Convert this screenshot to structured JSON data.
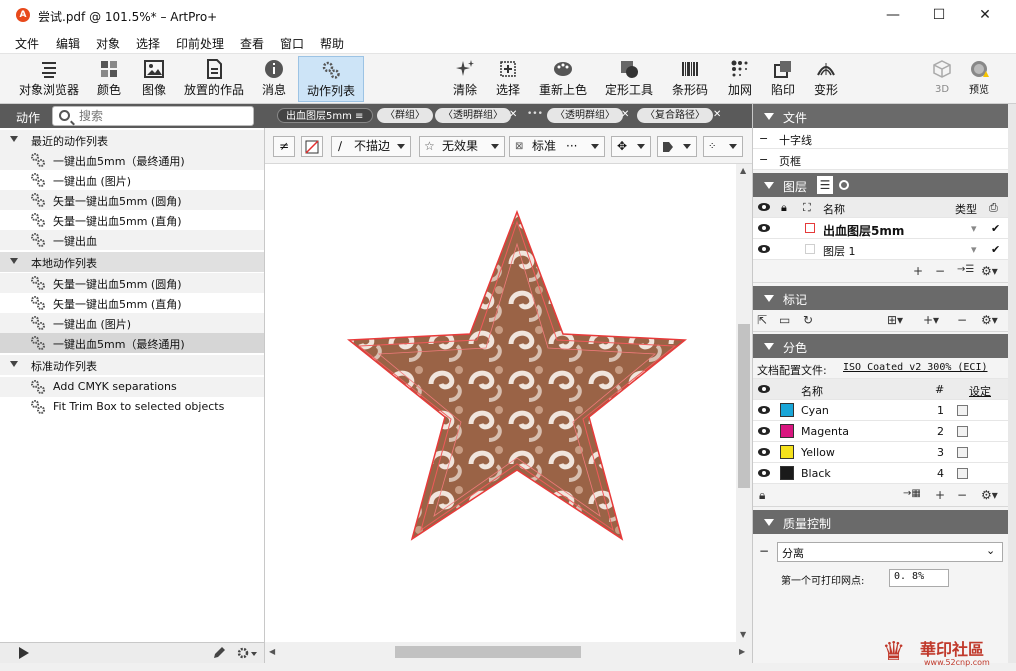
{
  "window": {
    "title": "尝试.pdf @ 101.5%* – ArtPro+",
    "minimize": "—",
    "maximize": "☐",
    "close": "✕"
  },
  "menu": [
    "文件",
    "编辑",
    "对象",
    "选择",
    "印前处理",
    "查看",
    "窗口",
    "帮助"
  ],
  "toolbar": {
    "left": [
      {
        "label": "对象浏览器",
        "icon": "object-browser-icon"
      },
      {
        "label": "颜色",
        "icon": "color-grid-icon"
      },
      {
        "label": "图像",
        "icon": "image-icon"
      },
      {
        "label": "放置的作品",
        "icon": "placed-art-icon"
      },
      {
        "label": "消息",
        "icon": "info-icon"
      },
      {
        "label": "动作列表",
        "icon": "gears-icon",
        "active": true
      }
    ],
    "right": [
      {
        "label": "清除",
        "icon": "sparkle-icon"
      },
      {
        "label": "选择",
        "icon": "select-icon"
      },
      {
        "label": "重新上色",
        "icon": "palette-icon"
      },
      {
        "label": "定形工具",
        "icon": "shape-icon"
      },
      {
        "label": "条形码",
        "icon": "barcode-icon"
      },
      {
        "label": "加网",
        "icon": "screening-icon"
      },
      {
        "label": "陷印",
        "icon": "trap-icon"
      },
      {
        "label": "变形",
        "icon": "distort-icon"
      },
      {
        "label": "3D",
        "icon": "cube-icon",
        "dim": true
      },
      {
        "label": "预览",
        "icon": "preview-icon"
      }
    ]
  },
  "actions_panel": {
    "header": "动作",
    "search_placeholder": "搜索",
    "groups": [
      {
        "title": "最近的动作列表",
        "items": [
          "一键出血5mm（最终通用)",
          "一键出血 (图片)",
          "矢量一键出血5mm (圆角)",
          "矢量一键出血5mm (直角)",
          "一键出血"
        ]
      },
      {
        "title": "本地动作列表",
        "items": [
          "矢量一键出血5mm (圆角)",
          "矢量一键出血5mm (直角)",
          "一键出血 (图片)",
          "一键出血5mm（最终通用)"
        ]
      },
      {
        "title": "标准动作列表",
        "items": [
          "Add CMYK separations",
          "Fit Trim Box to selected objects"
        ]
      }
    ]
  },
  "breadcrumb": {
    "layer": "出血图层5mm",
    "tags": [
      "〈群组〉",
      "〈透明群组〉",
      "〈透明群组〉",
      "〈复合路径〉"
    ],
    "ellipsis": "•••"
  },
  "options_bar": {
    "stroke": "不描边",
    "effect": "无效果",
    "blend": "标准",
    "blend_more": "···"
  },
  "right_panel": {
    "file": {
      "title": "文件",
      "items": [
        "十字线",
        "页框"
      ]
    },
    "layers": {
      "title": "图层",
      "col_name": "名称",
      "col_type": "类型",
      "rows": [
        {
          "name": "出血图层5mm",
          "color": "#e53a3a",
          "bold": true
        },
        {
          "name": "图层 1",
          "color": "#cfcfcf",
          "bold": false
        }
      ]
    },
    "marks": {
      "title": "标记"
    },
    "separations": {
      "title": "分色",
      "profile_label": "文档配置文件:",
      "profile_value": "ISO Coated v2 300% (ECI)",
      "col_name": "名称",
      "col_num": "#",
      "col_setting": "设定",
      "inks": [
        {
          "name": "Cyan",
          "num": "1",
          "color": "#19a6d8"
        },
        {
          "name": "Magenta",
          "num": "2",
          "color": "#d8167f"
        },
        {
          "name": "Yellow",
          "num": "3",
          "color": "#f5e11c"
        },
        {
          "name": "Black",
          "num": "4",
          "color": "#1a1a1a"
        }
      ]
    },
    "qc": {
      "title": "质量控制",
      "select_value": "分离",
      "first_dot_label": "第一个可打印网点:",
      "first_dot_value": "0. 8%"
    }
  },
  "watermark": {
    "text": "華印社區",
    "url": "www.52cnp.com"
  }
}
